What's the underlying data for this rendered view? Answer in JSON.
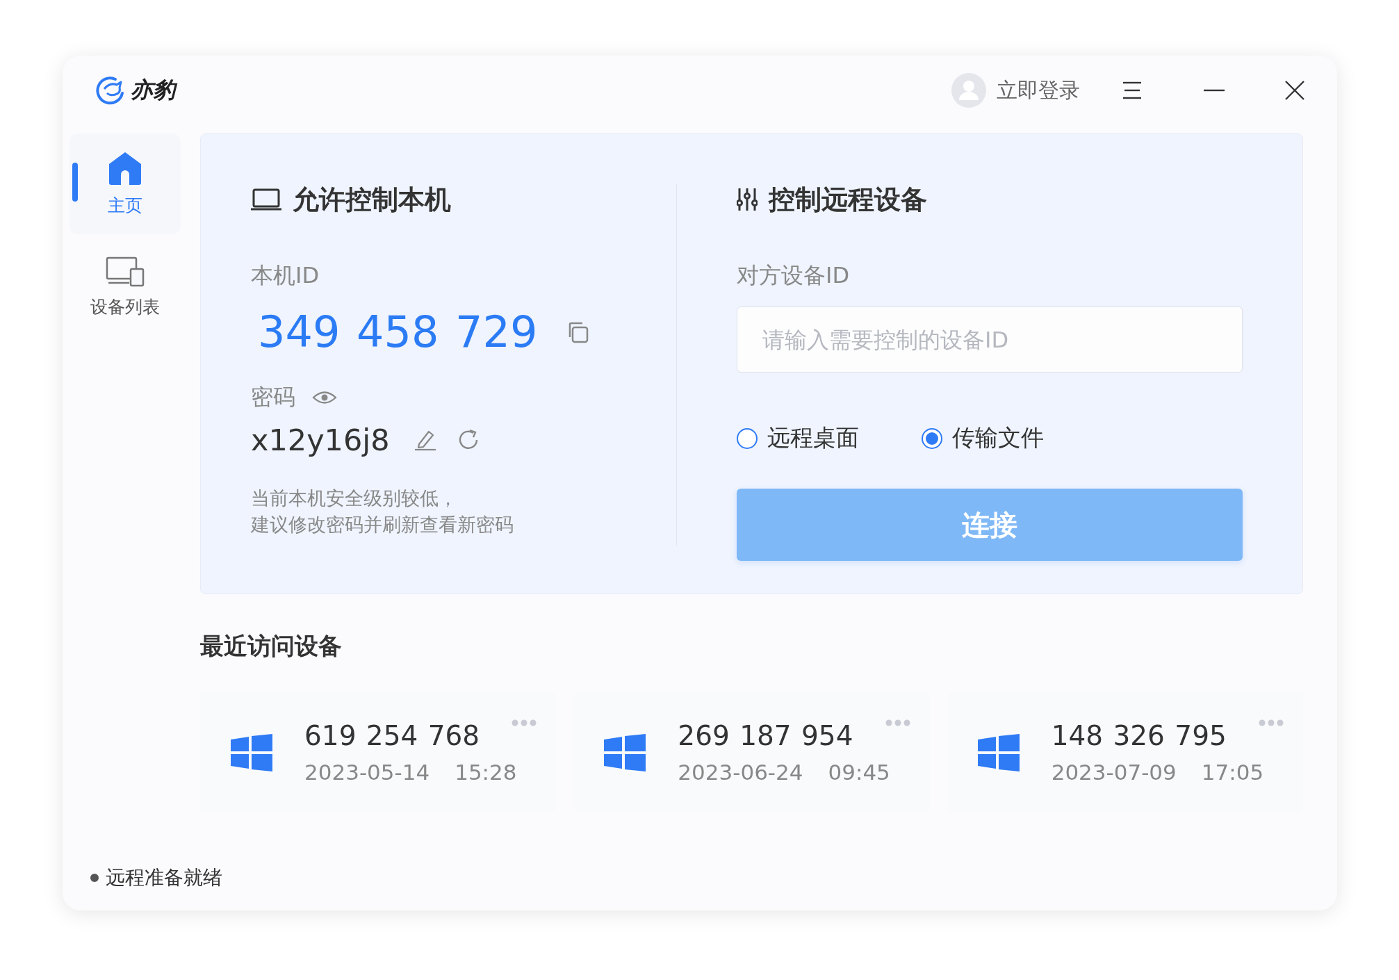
{
  "app": {
    "name": "亦豹"
  },
  "header": {
    "login": "立即登录"
  },
  "sidebar": {
    "items": [
      {
        "label": "主页",
        "kind": "home",
        "selected": true
      },
      {
        "label": "设备列表",
        "kind": "devices",
        "selected": false
      }
    ]
  },
  "local": {
    "title": "允许控制本机",
    "id_label": "本机ID",
    "id": "349 458 729",
    "password_label": "密码",
    "password": "x12y16j8",
    "note_lines": [
      "当前本机安全级别较低，",
      "建议修改密码并刷新查看新密码"
    ]
  },
  "remote": {
    "title": "控制远程设备",
    "id_label": "对方设备ID",
    "placeholder": "请输入需要控制的设备ID",
    "modes": [
      {
        "label": "远程桌面",
        "selected": false
      },
      {
        "label": "传输文件",
        "selected": true
      }
    ],
    "connect": "连接"
  },
  "recent": {
    "title": "最近访问设备",
    "devices": [
      {
        "id": "619 254 768",
        "date": "2023-05-14",
        "time": "15:28"
      },
      {
        "id": "269 187 954",
        "date": "2023-06-24",
        "time": "09:45"
      },
      {
        "id": "148 326 795",
        "date": "2023-07-09",
        "time": "17:05"
      }
    ]
  },
  "status_bar": {
    "text": "远程准备就绪"
  }
}
